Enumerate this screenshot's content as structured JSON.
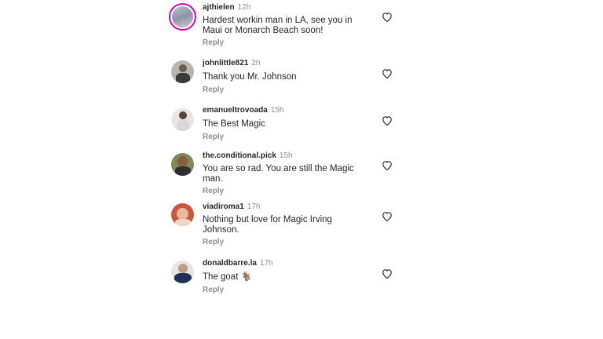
{
  "comments": [
    {
      "username": "ajthielen",
      "time": "12h",
      "text": "Hardest workin man in LA, see you in Maui or Monarch Beach soon!",
      "reply": "Reply"
    },
    {
      "username": "johnlittle821",
      "time": "2h",
      "text": "Thank you Mr. Johnson",
      "reply": "Reply"
    },
    {
      "username": "emanueltrovoada",
      "time": "15h",
      "text": "The Best Magic",
      "reply": "Reply"
    },
    {
      "username": "the.conditional.pick",
      "time": "15h",
      "text": "You are so rad. You are still the Magic man.",
      "reply": "Reply"
    },
    {
      "username": "viadiroma1",
      "time": "17h",
      "text": "Nothing but love for Magic Irving Johnson.",
      "reply": "Reply"
    },
    {
      "username": "donaldbarre.la",
      "time": "17h",
      "text": "The goat 🐐",
      "reply": "Reply"
    }
  ],
  "icons": {
    "like": "heart-outline-icon",
    "avatar": "user-avatar",
    "story_ring": "story-ring"
  },
  "colors": {
    "username": "#262626",
    "meta": "#8e8e8e",
    "story_ring": "#d300c5",
    "background": "#ffffff"
  }
}
